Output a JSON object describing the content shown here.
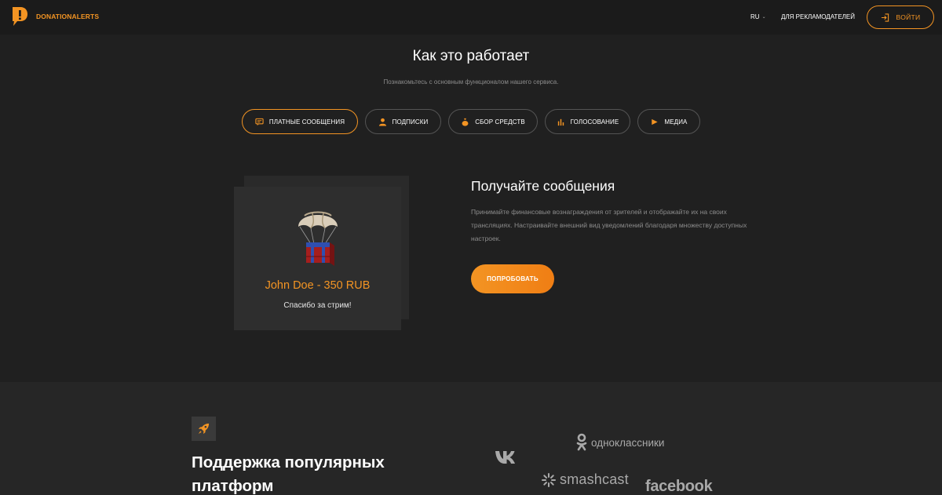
{
  "header": {
    "brand": "DONATIONALERTS",
    "lang": "RU",
    "advertisers": "ДЛЯ РЕКЛАМОДАТЕЛЕЙ",
    "login": "ВОЙТИ"
  },
  "how_it_works": {
    "title": "Как это работает",
    "subtitle": "Познакомьтесь с основным функционалом нашего сервиса.",
    "tabs": [
      {
        "label": "ПЛАТНЫЕ СООБЩЕНИЯ",
        "icon": "message-icon",
        "active": true
      },
      {
        "label": "ПОДПИСКИ",
        "icon": "user-icon",
        "active": false
      },
      {
        "label": "СБОР СРЕДСТВ",
        "icon": "money-bag-icon",
        "active": false
      },
      {
        "label": "ГОЛОСОВАНИЕ",
        "icon": "bar-chart-icon",
        "active": false
      },
      {
        "label": "МЕДИА",
        "icon": "play-icon",
        "active": false
      }
    ]
  },
  "demo_alert": {
    "name": "John Doe - 350 RUB",
    "message": "Спасибо за стрим!"
  },
  "feature": {
    "title": "Получайте сообщения",
    "description": "Принимайте финансовые вознаграждения от зрителей и отображайте их на своих трансляциях. Настраивайте внешний вид уведомлений благодаря множеству доступных настроек.",
    "cta": "ПОПРОБОВАТЬ"
  },
  "platforms": {
    "title": "Поддержка популярных платформ",
    "logos": {
      "odnoklassniki": "одноклассники",
      "smashcast": "smashcast",
      "facebook": "facebook"
    }
  },
  "colors": {
    "accent": "#f39423",
    "background": "#202020",
    "header": "#1b1b1b",
    "muted_text": "#8c8c8c"
  }
}
